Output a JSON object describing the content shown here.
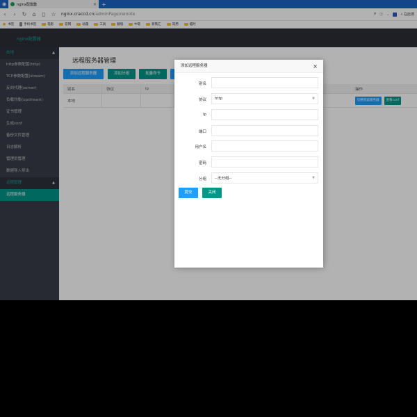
{
  "browser": {
    "tab_title": "nginx配置器",
    "tab_close": "×",
    "new_tab": "+",
    "url_host": "nginx.craccd.cn",
    "url_path": "/adminPage/remote",
    "ext_f": "F",
    "ext_share": "ⓡ",
    "ext_more": "⌄",
    "ext_search_label": "• 在此搜"
  },
  "bookmarks": [
    {
      "label": "书签",
      "icon": "star-icon"
    },
    {
      "label": "手机书签",
      "icon": "mobile-icon"
    },
    {
      "label": "电影",
      "icon": "folder-icon"
    },
    {
      "label": "官网",
      "icon": "folder-icon"
    },
    {
      "label": "动漫",
      "icon": "folder-icon"
    },
    {
      "label": "工具",
      "icon": "folder-icon"
    },
    {
      "label": "翻墙",
      "icon": "folder-icon"
    },
    {
      "label": "中软",
      "icon": "folder-icon"
    },
    {
      "label": "新铁汇",
      "icon": "folder-icon"
    },
    {
      "label": "常用",
      "icon": "folder-icon"
    },
    {
      "label": "临时",
      "icon": "folder-icon"
    }
  ],
  "app": {
    "title": "nginx配置器"
  },
  "sidebar": {
    "group_local": "本地",
    "items": [
      "http参数配置(http)",
      "TCP参数配置(stream)",
      "反向代理(server)",
      "负载均衡(upstream)",
      "证书管理",
      "生成conf",
      "备份文件管理",
      "日志解析",
      "管理员管理",
      "数据导入导出"
    ],
    "group_remote": "远程管理",
    "active_item": "远程服务器"
  },
  "main": {
    "page_title": "远程服务器管理",
    "buttons": {
      "add_server": "添加远程服务器",
      "add_group": "添加分组",
      "batch_cmd": "批量命令"
    },
    "table": {
      "headers": [
        "别名",
        "协议",
        "ip",
        "操作"
      ],
      "row": {
        "alias": "本地",
        "switch_btn": "切换到此服务器",
        "view_conf_btn": "查看conf"
      }
    }
  },
  "modal": {
    "title": "添加远程服务器",
    "close": "×",
    "fields": {
      "alias_label": "别名",
      "protocol_label": "协议",
      "protocol_value": "http",
      "ip_label": "ip",
      "port_label": "端口",
      "username_label": "用户名",
      "password_label": "密码",
      "group_label": "分组",
      "group_value": "--无分组--"
    },
    "submit": "提交",
    "close_btn": "关闭"
  },
  "colors": {
    "accent_green": "#009688",
    "accent_blue": "#1e9fff",
    "sidebar_bg": "#393d49",
    "header_bg": "#2b2e37",
    "brand_teal": "#1aa094"
  }
}
